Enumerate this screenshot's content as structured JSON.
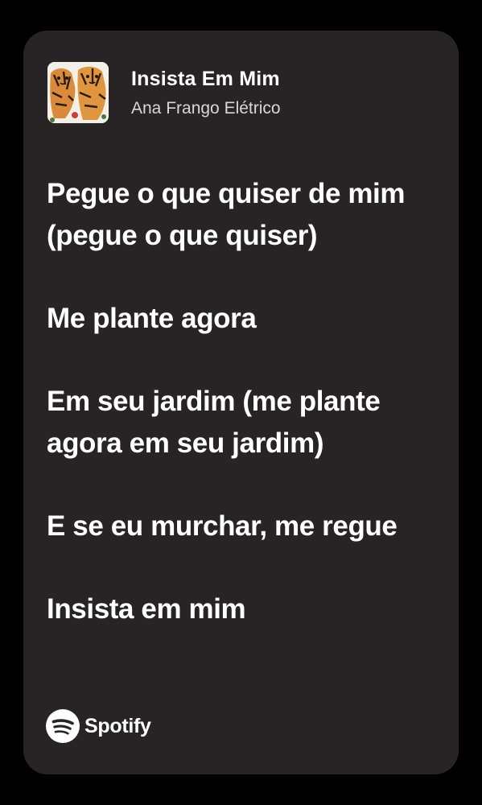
{
  "track": {
    "title": "Insista Em Mim",
    "artist": "Ana Frango Elétrico",
    "cover_art_icon": "album-cover-tigers"
  },
  "lyrics": [
    "Pegue o que quiser de mim (pegue o que quiser)",
    "Me plante agora",
    "Em seu jardim (me plante agora em seu jardim)",
    "E se eu murchar, me regue",
    "Insista em mim"
  ],
  "footer": {
    "brand_icon": "spotify-logo-icon",
    "brand_name": "Spotify"
  },
  "colors": {
    "page_background": "#000000",
    "card_background": "#282324",
    "text_primary": "#ffffff",
    "text_secondary": "#d9d6d6"
  }
}
